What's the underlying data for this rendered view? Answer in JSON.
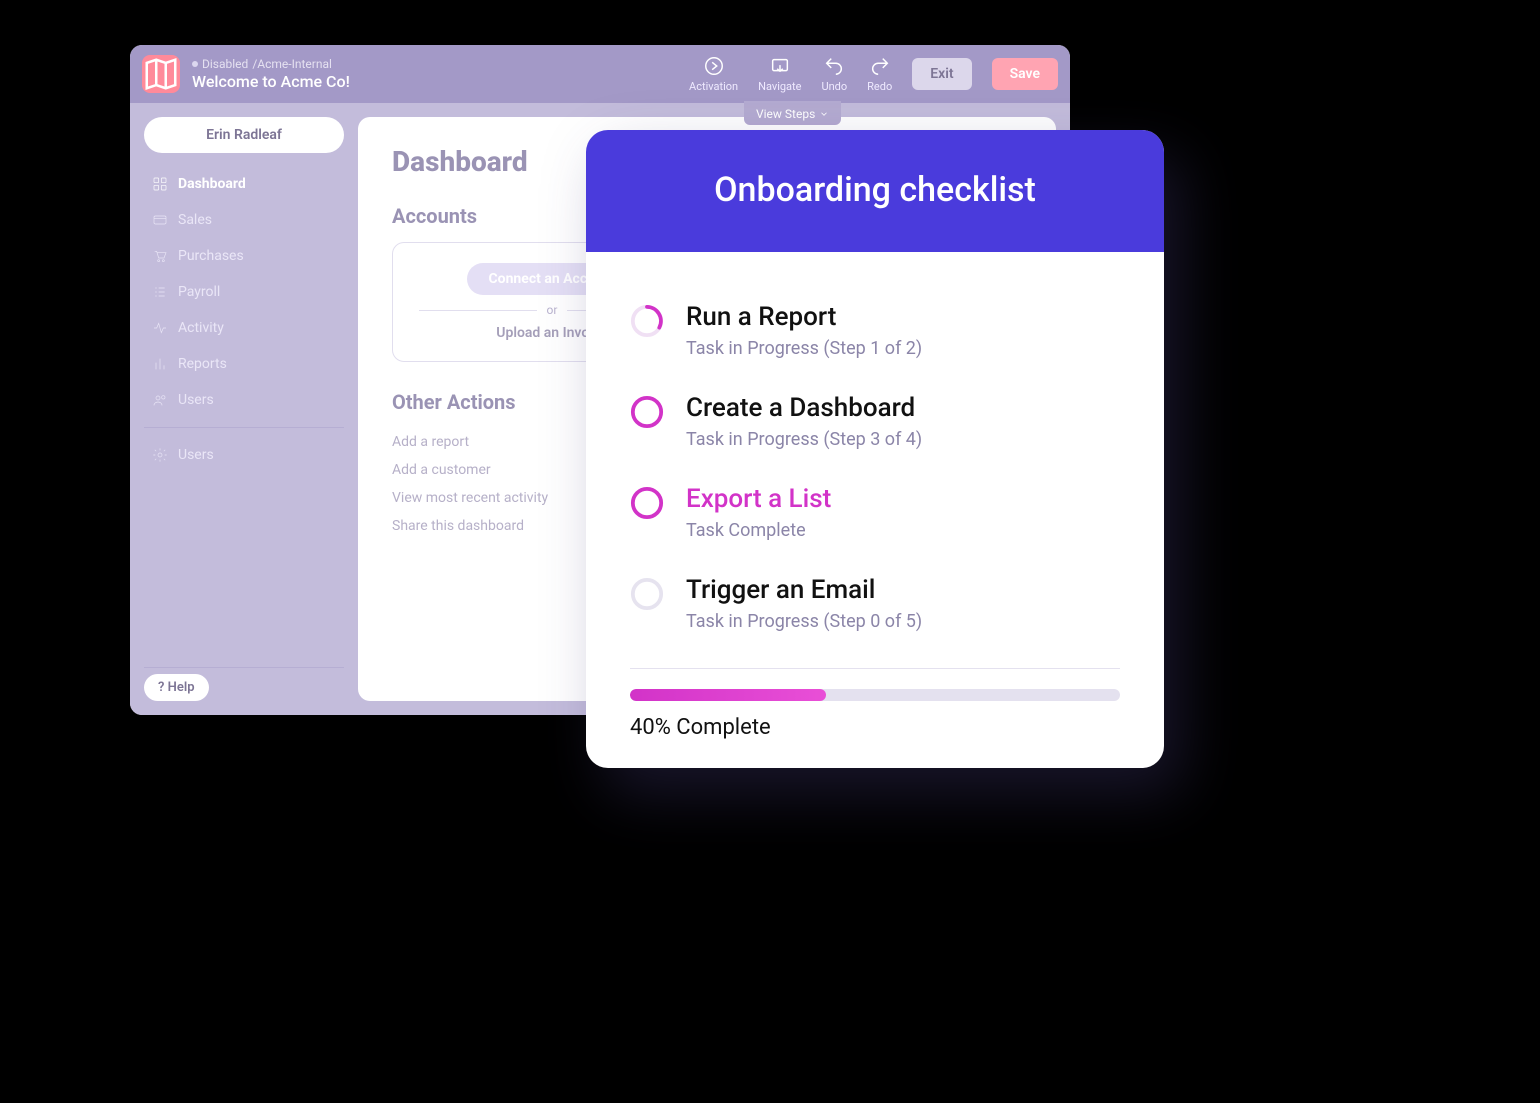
{
  "builder": {
    "status_label": "Disabled",
    "workspace": "/Acme-Internal",
    "title": "Welcome to Acme Co!",
    "toolbar": {
      "activation": "Activation",
      "navigate": "Navigate",
      "undo": "Undo",
      "redo": "Redo",
      "exit": "Exit",
      "save": "Save"
    },
    "view_steps": "View Steps"
  },
  "sidebar": {
    "user": "Erin Radleaf",
    "items": [
      {
        "label": "Dashboard"
      },
      {
        "label": "Sales"
      },
      {
        "label": "Purchases"
      },
      {
        "label": "Payroll"
      },
      {
        "label": "Activity"
      },
      {
        "label": "Reports"
      },
      {
        "label": "Users"
      }
    ],
    "settings_label": "Users",
    "help": "? Help"
  },
  "canvas": {
    "heading": "Dashboard",
    "accounts_heading": "Accounts",
    "connect_label": "Connect an Account",
    "or": "or",
    "upload_label": "Upload an Invoice",
    "other_heading": "Other Actions",
    "actions": [
      "Add a report",
      "Add a customer",
      "View most recent activity",
      "Share this dashboard"
    ]
  },
  "checklist": {
    "title": "Onboarding checklist",
    "tasks": [
      {
        "title": "Run a Report",
        "sub": "Task in Progress (Step 1 of 2)",
        "ring": "partial",
        "highlight": false
      },
      {
        "title": "Create a Dashboard",
        "sub": "Task in Progress (Step 3 of 4)",
        "ring": "open",
        "highlight": false
      },
      {
        "title": "Export a List",
        "sub": "Task Complete",
        "ring": "open",
        "highlight": true
      },
      {
        "title": "Trigger an Email",
        "sub": "Task in Progress (Step 0 of 5)",
        "ring": "muted",
        "highlight": false
      }
    ],
    "progress_pct": 40,
    "progress_label": "40% Complete"
  }
}
